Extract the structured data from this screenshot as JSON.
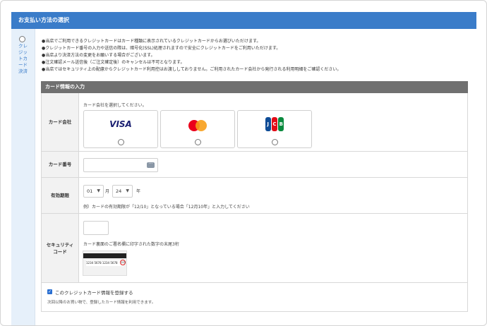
{
  "section_title": "お支払い方法の選択",
  "payment_method": {
    "label_lines": [
      "クレ",
      "ジッ",
      "トカ",
      "ード",
      "決済"
    ]
  },
  "notes": [
    "●当店でご利用できるクレジットカードはカード種類に表示されているクレジットカードからお選びいただけます。",
    "●クレジットカード番号の入力や送信の際は、暗号化(SSL)処理されますので安全にクレジットカードをご利用いただけます。",
    "●当店より決済方法の変更をお願いする場合がございます。",
    "●注文確認メール送信後（ご注文確定後）のキャンセルは不可となります。",
    "●当店ではセキュリティ上の配慮からクレジットカード利用控はお渡ししておりません。ご利用されたカード会社から発行される利用明細をご確認ください。"
  ],
  "card_form": {
    "header": "カード情報の入力",
    "company": {
      "label": "カード会社",
      "instruction": "カード会社を選択してください。",
      "brands": [
        "VISA",
        "Mastercard",
        "JCB"
      ]
    },
    "number": {
      "label": "カード番号",
      "value": ""
    },
    "expiry": {
      "label": "有効期限",
      "month": "01",
      "month_unit": "月",
      "year": "24",
      "year_unit": "年",
      "example": "例）カードの有効期限が「12/10」となっている場合「12月10年」と入力してください"
    },
    "security": {
      "label_lines": [
        "セキュリティ",
        "コード"
      ],
      "value": "",
      "instruction": "カード裏面のご署名欄に印字された数字の末尾3桁",
      "sample_number": "1234 5678 1234 5678",
      "sample_code": "123"
    },
    "save_card": {
      "checked": true,
      "label": "このクレジットカード情報を登録する",
      "note": "次回以降のお買い物で、登録したカード情報を利用できます。"
    }
  },
  "colors": {
    "header_bg": "#3a7cc9",
    "sidebar_bg": "#e6f0fa",
    "card_header_bg": "#707070",
    "visa": "#1a1f71",
    "checkbox": "#2a6fd1"
  }
}
